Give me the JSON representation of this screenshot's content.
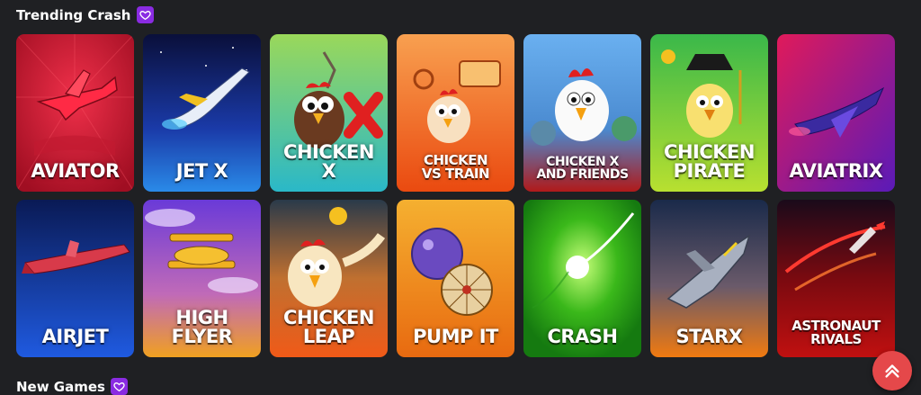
{
  "sections": {
    "trending": {
      "title": "Trending Crash",
      "badge_icon": "heart-icon"
    },
    "new": {
      "title": "New Games",
      "badge_icon": "heart-icon"
    }
  },
  "games": [
    {
      "title": "AVIATOR",
      "colors": [
        "#b3122b",
        "#e01a3a"
      ]
    },
    {
      "title": "JET X",
      "colors": [
        "#0a1a55",
        "#1a5ad8"
      ]
    },
    {
      "title": "CHICKEN\nX",
      "colors": [
        "#3cc3c0",
        "#87d85a"
      ]
    },
    {
      "title": "CHICKEN\nVS TRAIN",
      "colors": [
        "#f59a3a",
        "#ef5a1a"
      ]
    },
    {
      "title": "CHICKEN X\nAND FRIENDS",
      "colors": [
        "#5aa5e8",
        "#b01a1a"
      ]
    },
    {
      "title": "CHICKEN\nPIRATE",
      "colors": [
        "#2f9a3f",
        "#a5d22a"
      ]
    },
    {
      "title": "AVIATRIX",
      "colors": [
        "#d8185a",
        "#6a1ab8"
      ]
    },
    {
      "title": "AIRJET",
      "colors": [
        "#0a1e6a",
        "#1f54d8"
      ]
    },
    {
      "title": "HIGH FLYER",
      "colors": [
        "#6a3ad8",
        "#f0a020"
      ]
    },
    {
      "title": "CHICKEN\nLEAP",
      "colors": [
        "#2a3a4a",
        "#f05a18"
      ]
    },
    {
      "title": "PUMP IT",
      "colors": [
        "#f0a020",
        "#e86a10"
      ]
    },
    {
      "title": "CRASH",
      "colors": [
        "#1a8a1a",
        "#4ad21a"
      ]
    },
    {
      "title": "STARX",
      "colors": [
        "#1a2a4a",
        "#f07a10"
      ]
    },
    {
      "title": "ASTRONAUT\nRIVALS",
      "colors": [
        "#1a0a1a",
        "#b01010"
      ]
    }
  ],
  "scroll_top": {
    "icon": "chevron-up-icon",
    "color": "#e5484a"
  }
}
